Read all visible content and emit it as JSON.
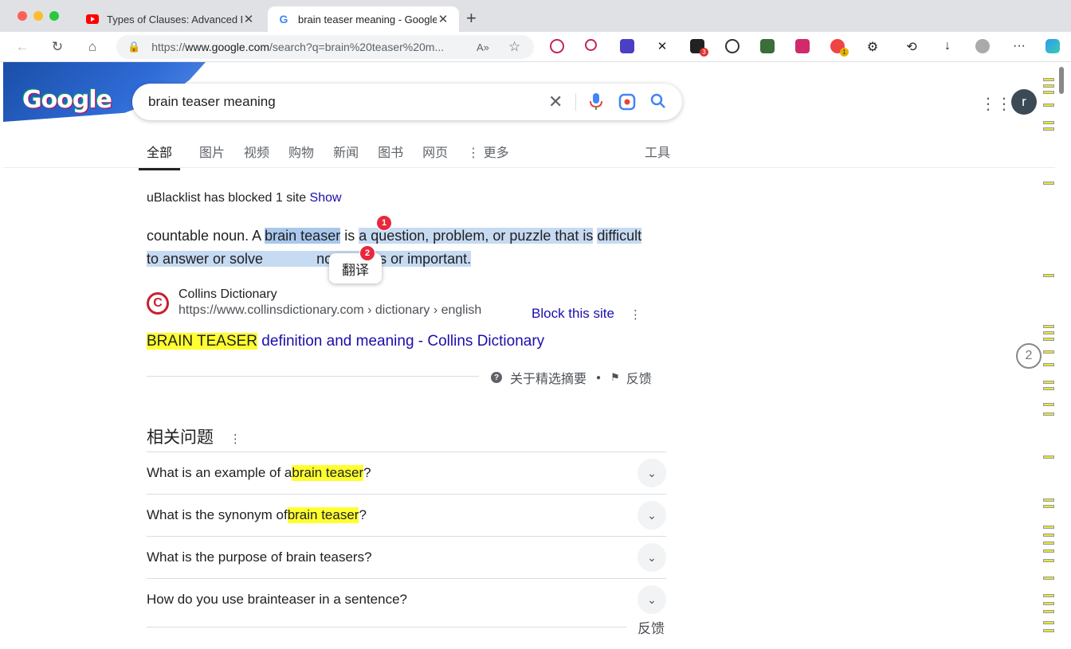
{
  "browser": {
    "tabs": [
      {
        "title": "Types of Clauses: Advanced Er",
        "favicon": "youtube-icon",
        "active": false
      },
      {
        "title": "brain teaser meaning - Google",
        "favicon": "google-icon",
        "active": true
      }
    ],
    "url_prefix": "https://",
    "url_host": "www.google.com",
    "url_path": "/search?q=brain%20teaser%20m..."
  },
  "search": {
    "query": "brain teaser meaning",
    "avatar_letter": "r",
    "doodle_text": "Google"
  },
  "nav_tabs": [
    "全部",
    "图片",
    "视频",
    "购物",
    "新闻",
    "图书",
    "网页"
  ],
  "more_label": "更多",
  "tools_label": "工具",
  "ublacklist": {
    "text": "uBlacklist has blocked 1 site ",
    "show": "Show"
  },
  "snippet": {
    "part1": "countable noun. A ",
    "highlight": "brain teaser",
    "part2": " is ",
    "line1_rest": "a question, problem, or puzzle that is",
    "line2_start": "difficult to answer or solve",
    "line2_end": " not serious or important."
  },
  "popup": {
    "label": "翻译",
    "badge1": "1",
    "badge2": "2"
  },
  "source": {
    "name": "Collins Dictionary",
    "url": "https://www.collinsdictionary.com › dictionary › english",
    "block_label": "Block this site",
    "logo_letter": "C"
  },
  "result": {
    "title_hl": "BRAIN TEASER",
    "title_rest": " definition and meaning - Collins Dictionary"
  },
  "about": {
    "label": "关于精选摘要",
    "feedback": "反馈"
  },
  "related": {
    "title": "相关问题",
    "questions": [
      {
        "pre": "What is an example of a ",
        "hl": "brain teaser",
        "post": "?"
      },
      {
        "pre": "What is the synonym of ",
        "hl": "brain teaser",
        "post": "?"
      },
      {
        "pre": "What is the purpose of brain teasers?",
        "hl": "",
        "post": ""
      },
      {
        "pre": "How do you use brainteaser in a sentence?",
        "hl": "",
        "post": ""
      }
    ],
    "feedback": "反馈"
  },
  "side_counter": "2",
  "colors": {
    "link": "#1a0dab",
    "highlight_yellow": "#ffff30",
    "selection": "#c6daf2",
    "badge_red": "#e8283c"
  }
}
